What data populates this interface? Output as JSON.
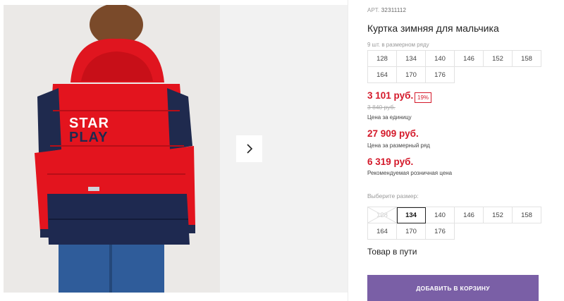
{
  "product": {
    "article_label": "АРТ.",
    "article": "32311112",
    "title": "Куртка зимняя для мальчика",
    "pack_note": "9 шт. в размерном ряду",
    "pack_sizes": [
      "128",
      "134",
      "140",
      "146",
      "152",
      "158",
      "164",
      "170",
      "176"
    ],
    "price": "3 101 руб.",
    "discount": "19%",
    "old_price": "3 840 руб.",
    "unit_caption": "Цена за единицу",
    "row_price": "27 909 руб.",
    "row_caption": "Цена за размерный ряд",
    "retail_price": "6 319 руб.",
    "retail_caption": "Рекомендуемая розничная цена",
    "select_label": "Выберите размер:",
    "select_sizes": [
      "128",
      "134",
      "140",
      "146",
      "152",
      "158",
      "164",
      "170",
      "176"
    ],
    "selected_size": "134",
    "unavailable_size": "128",
    "availability": "Товар в пути",
    "add_to_cart": "ДОБАВИТЬ В КОРЗИНУ"
  },
  "photo": {
    "back_print_line1": "STAR",
    "back_print_line2": "PLAY"
  },
  "colors": {
    "accent_red": "#d4192a",
    "cart_button": "#7a5fa6"
  },
  "icons": {
    "next": "chevron-right-icon"
  }
}
